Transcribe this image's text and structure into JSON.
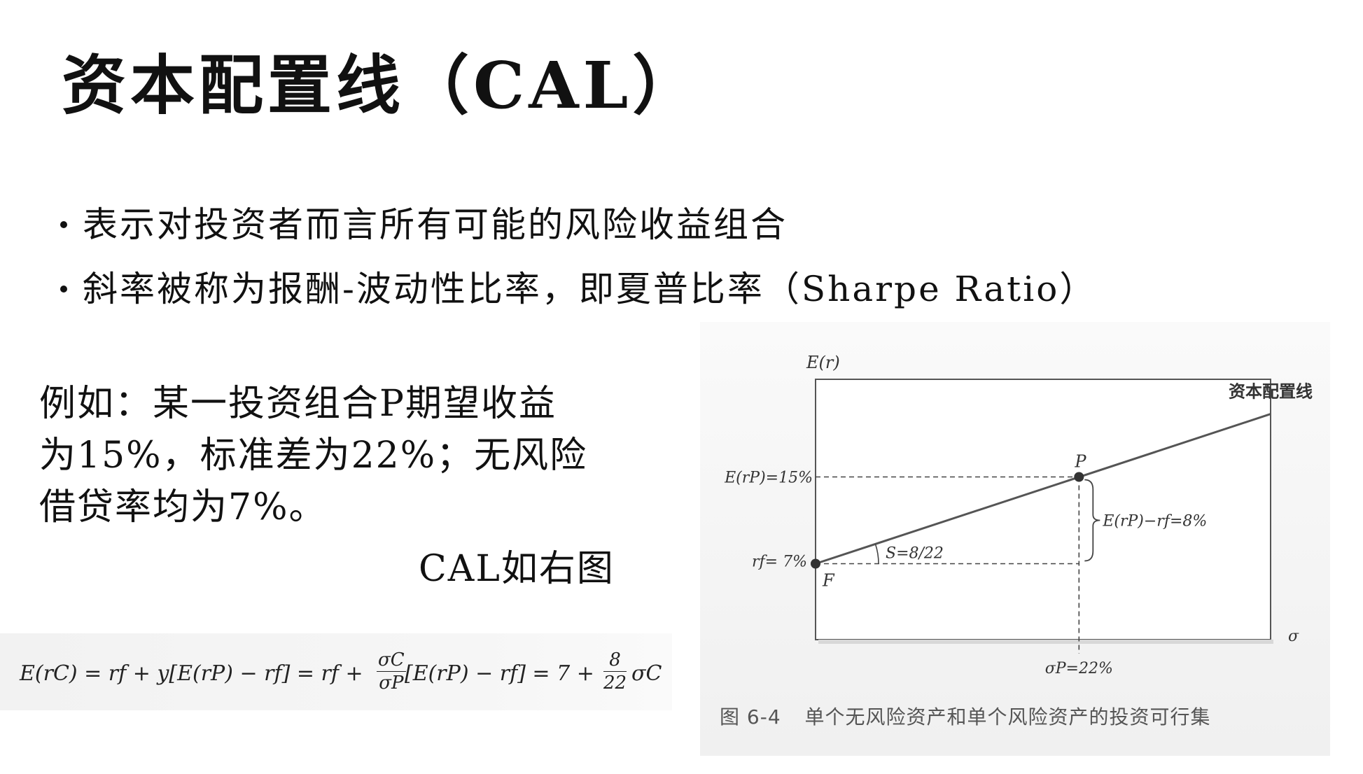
{
  "slide": {
    "title": "资本配置线（CAL）",
    "bullets": [
      "表示对投资者而言所有可能的风险收益组合",
      "斜率被称为报酬-波动性比率，即夏普比率（Sharpe Ratio）"
    ],
    "example_lines": [
      "例如：某一投资组合P期望收益",
      "为15%，标准差为22%；无风险",
      "借贷率均为7%。"
    ],
    "cal_note": "CAL如右图",
    "formula": {
      "main": "E(r",
      "lhs": "E(rC) = rf + y[E(rP) − rf] = rf + ",
      "frac1_num": "σC",
      "frac1_den": "σP",
      "mid": "[E(rP) − rf] = 7 + ",
      "frac2_num": "8",
      "frac2_den": "22",
      "tail": "σC"
    }
  },
  "chart_data": {
    "type": "line",
    "title": "",
    "xlabel": "σ",
    "ylabel": "E(r)",
    "series": [
      {
        "name": "资本配置线",
        "points": [
          [
            0,
            7
          ],
          [
            22,
            15
          ],
          [
            38,
            20.8
          ]
        ]
      }
    ],
    "points": [
      {
        "label": "F",
        "x": 0,
        "y": 7
      },
      {
        "label": "P",
        "x": 22,
        "y": 15
      }
    ],
    "xlim": [
      0,
      38
    ],
    "ylim": [
      0,
      24
    ],
    "annotations": {
      "erp": "E(rP)=15%",
      "rf": "rf= 7%",
      "sigma_p": "σP=22%",
      "slope": "S=8/22",
      "premium": "E(rP)−rf=8%",
      "line_label": "资本配置线",
      "point_p": "P",
      "point_f": "F"
    },
    "grid": false
  },
  "figure": {
    "caption_number": "图 6-4",
    "caption_text": "单个无风险资产和单个风险资产的投资可行集"
  },
  "colors": {
    "text": "#111111",
    "line": "#555555",
    "dashed": "#444444",
    "caption": "#555555"
  }
}
